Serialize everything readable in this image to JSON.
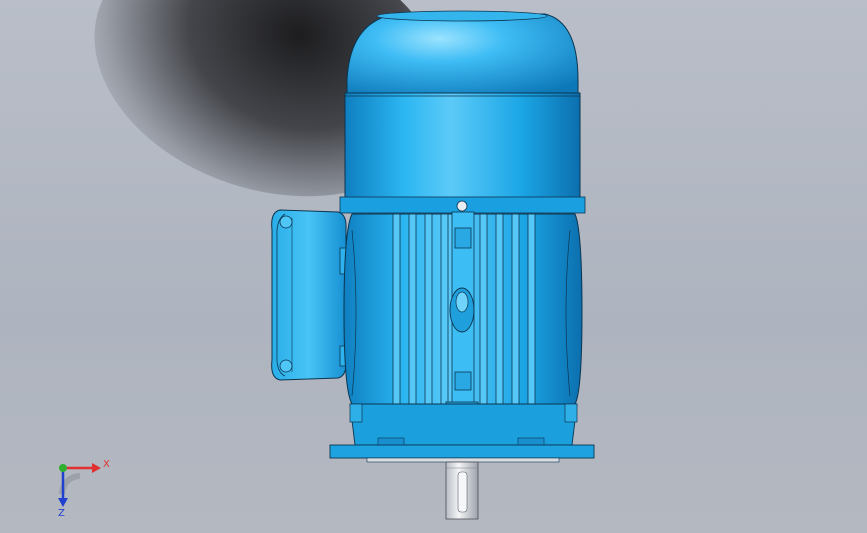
{
  "viewport": {
    "background": "#b4b9c3",
    "shadow_color": "#1e1e22"
  },
  "motor": {
    "body_color": "#1aa9e8",
    "highlight_color": "#7fd8ff",
    "outline_color": "#0b3550",
    "shaft_color": "#e4e6ea"
  },
  "triad": {
    "x_label": "X",
    "z_label": "Z",
    "x_color": "#e03030",
    "y_color": "#30b030",
    "z_color": "#2040d0"
  }
}
